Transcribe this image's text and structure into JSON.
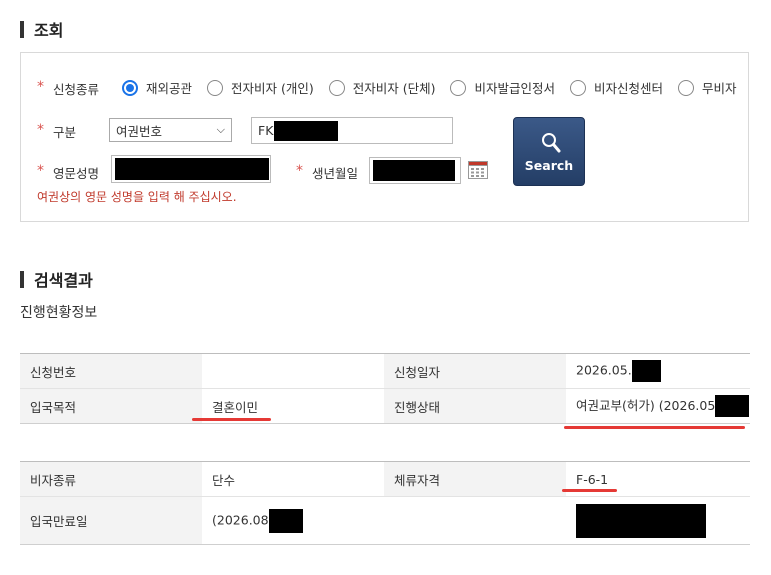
{
  "section_lookup": {
    "title": "조회"
  },
  "form": {
    "app_type": {
      "label": "신청종류",
      "options": [
        "재외공관",
        "전자비자 (개인)",
        "전자비자 (단체)",
        "비자발급인정서",
        "비자신청센터",
        "무비자"
      ],
      "selected_index": 0
    },
    "category": {
      "label": "구분",
      "selected": "여권번호",
      "value_prefix": "FK"
    },
    "english_name": {
      "label": "영문성명"
    },
    "birth_date": {
      "label": "생년월일"
    },
    "hint": "여권상의 영문 성명을 입력 해 주십시오.",
    "search_label": "Search"
  },
  "section_results": {
    "title": "검색결과"
  },
  "progress_info_title": "진행현황정보",
  "table1": [
    {
      "label": "신청번호",
      "value": "",
      "label2": "신청일자",
      "value2": "2026.05."
    },
    {
      "label": "입국목적",
      "value": "결혼이민",
      "label2": "진행상태",
      "value2": "여권교부(허가) (2026.05"
    }
  ],
  "table2": [
    {
      "label": "비자종류",
      "value": "단수",
      "label2": "체류자격",
      "value2": "F-6-1"
    },
    {
      "label": "입국만료일",
      "value": "(2026.08",
      "label2": "",
      "value2": ""
    }
  ],
  "colors": {
    "accent": "#1a73e8",
    "required": "#d9534f",
    "underline": "#e53935",
    "button": "#2f4a77"
  }
}
